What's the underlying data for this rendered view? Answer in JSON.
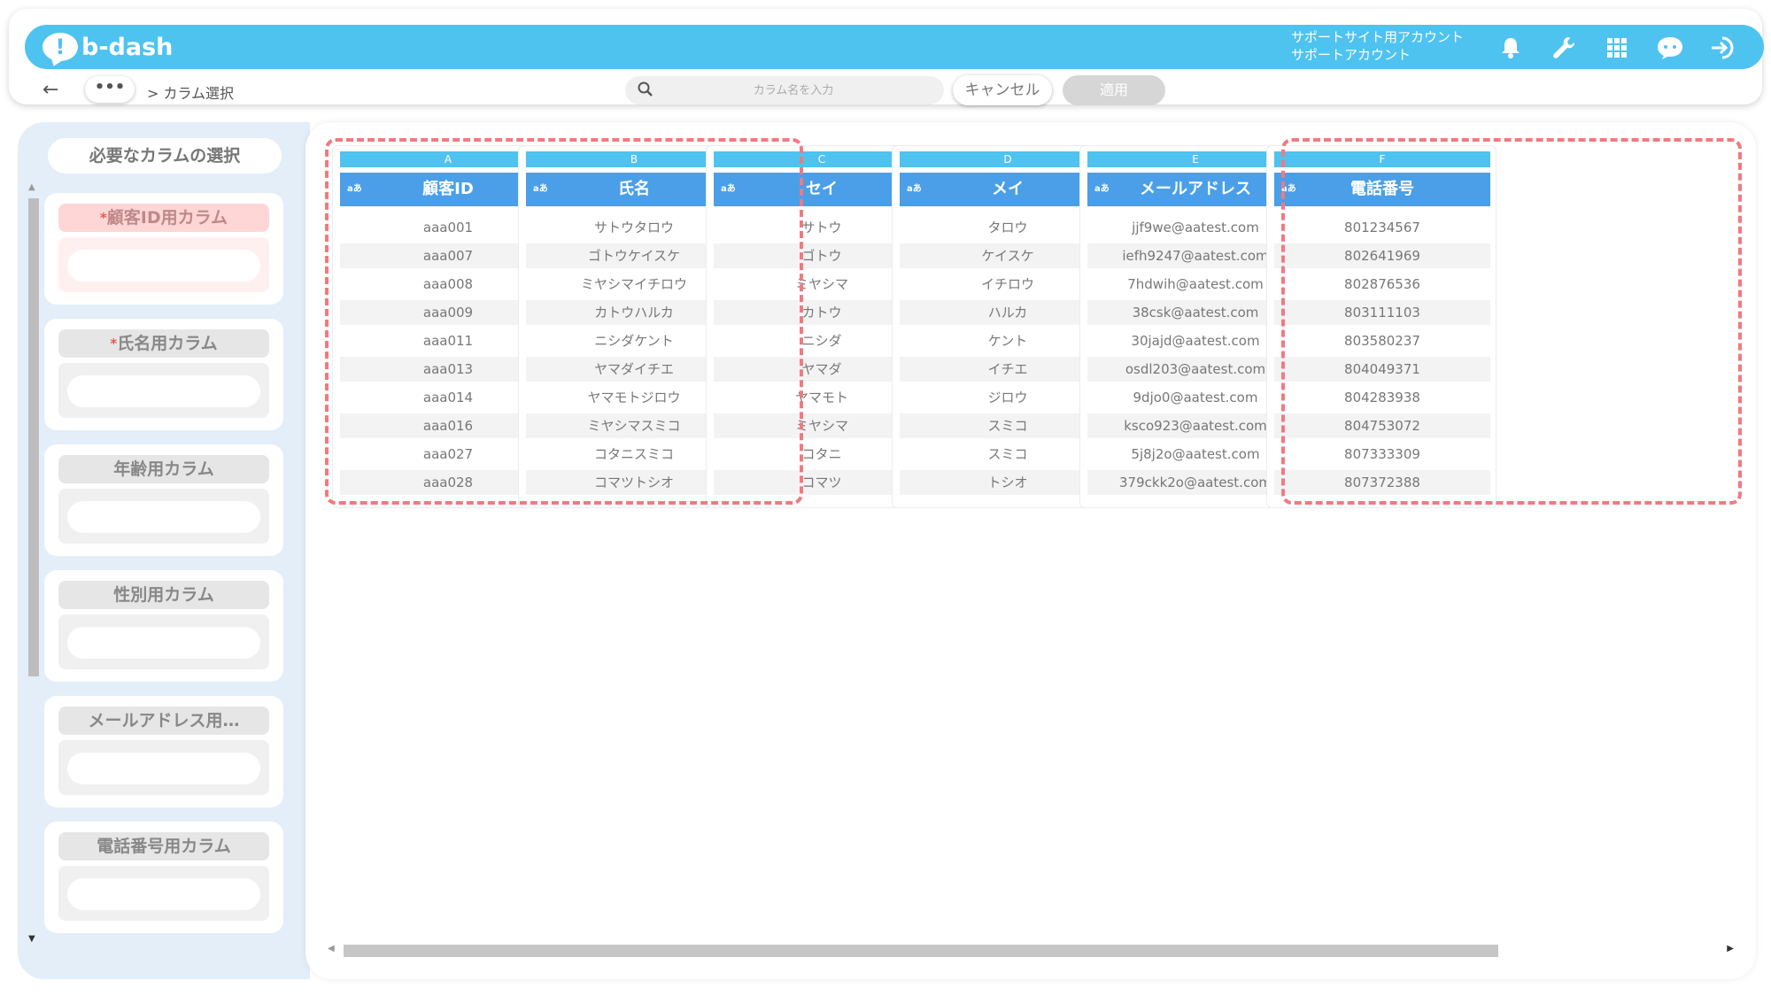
{
  "app": {
    "logo_text": "b-dash",
    "logo_mark": "!",
    "account_line1": "サポートサイト用アカウント",
    "account_line2": "サポートアカウント"
  },
  "toolbar": {
    "back_icon": "←",
    "breadcrumb_more": "•••",
    "breadcrumb_current": "> カラム選択",
    "search_placeholder": "カラム名を入力",
    "cancel_label": "キャンセル",
    "apply_label": "適用"
  },
  "left_panel": {
    "title": "必要なカラムの選択",
    "required_mark": "*",
    "slots": [
      {
        "label": "顧客ID用カラム",
        "required": true
      },
      {
        "label": "氏名用カラム",
        "required": true
      },
      {
        "label": "年齢用カラム",
        "required": false
      },
      {
        "label": "性別用カラム",
        "required": false
      },
      {
        "label": "メールアドレス用…",
        "required": false
      },
      {
        "label": "電話番号用カラム",
        "required": false
      }
    ]
  },
  "columns": [
    {
      "letter": "A",
      "type": "aあ",
      "header": "顧客ID",
      "values": [
        "aaa001",
        "aaa007",
        "aaa008",
        "aaa009",
        "aaa011",
        "aaa013",
        "aaa014",
        "aaa016",
        "aaa027",
        "aaa028"
      ]
    },
    {
      "letter": "B",
      "type": "aあ",
      "header": "氏名",
      "values": [
        "サトウタロウ",
        "ゴトウケイスケ",
        "ミヤシマイチロウ",
        "カトウハルカ",
        "ニシダケント",
        "ヤマダイチエ",
        "ヤマモトジロウ",
        "ミヤシマスミコ",
        "コタニスミコ",
        "コマツトシオ"
      ]
    },
    {
      "letter": "C",
      "type": "aあ",
      "header": "セイ",
      "values": [
        "サトウ",
        "ゴトウ",
        "ミヤシマ",
        "カトウ",
        "ニシダ",
        "ヤマダ",
        "ヤマモト",
        "ミヤシマ",
        "コタニ",
        "コマツ"
      ]
    },
    {
      "letter": "D",
      "type": "aあ",
      "header": "メイ",
      "values": [
        "タロウ",
        "ケイスケ",
        "イチロウ",
        "ハルカ",
        "ケント",
        "イチエ",
        "ジロウ",
        "スミコ",
        "スミコ",
        "トシオ"
      ]
    },
    {
      "letter": "E",
      "type": "aあ",
      "header": "メールアドレス",
      "values": [
        "jjf9we@aatest.com",
        "iefh9247@aatest.com",
        "7hdwih@aatest.com",
        "38csk@aatest.com",
        "30jajd@aatest.com",
        "osdl203@aatest.com",
        "9djo0@aatest.com",
        "ksco923@aatest.com",
        "5j8j2o@aatest.com",
        "379ckk2o@aatest.com"
      ]
    },
    {
      "letter": "F",
      "type": "aあ",
      "header": "電話番号",
      "values": [
        "801234567",
        "802641969",
        "802876536",
        "803111103",
        "803580237",
        "804049371",
        "804283938",
        "804753072",
        "807333309",
        "807372388"
      ]
    }
  ],
  "colors": {
    "brand": "#4fc3ef",
    "header": "#4a9fe8",
    "highlight": "#f07a80"
  }
}
